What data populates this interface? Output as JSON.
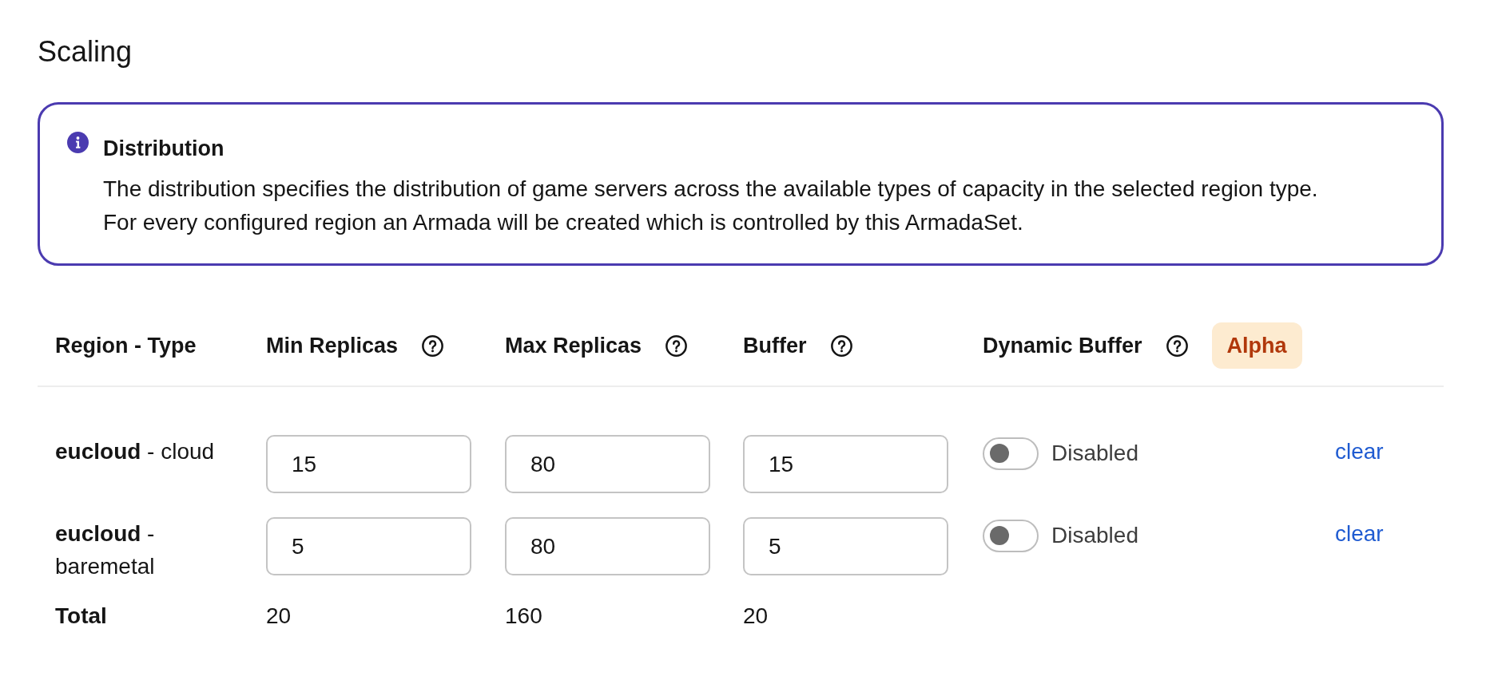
{
  "title": "Scaling",
  "alert": {
    "kind": "info",
    "title": "Distribution",
    "lines": [
      "The distribution specifies the distribution of game servers across the available types of capacity in the selected region type.",
      "For every configured region an Armada will be created which is controlled by this ArmadaSet."
    ]
  },
  "table": {
    "columns": [
      {
        "label": "Region - Type",
        "help": false
      },
      {
        "label": "Min Replicas",
        "help": true
      },
      {
        "label": "Max Replicas",
        "help": true
      },
      {
        "label": "Buffer",
        "help": true
      },
      {
        "label": "Dynamic Buffer",
        "help": true,
        "badge": "Alpha"
      }
    ],
    "rows": [
      {
        "region": "**eucloud** - cloud",
        "min_replicas": "15",
        "max_replicas": "80",
        "buffer": "15",
        "dynamic_buffer": {
          "on": false,
          "label": "Disabled"
        },
        "action": "clear"
      },
      {
        "region": "**eucloud** - baremetal",
        "min_replicas": "5",
        "max_replicas": "80",
        "buffer": "5",
        "dynamic_buffer": {
          "on": false,
          "label": "Disabled"
        },
        "action": "clear"
      }
    ],
    "total": {
      "label": "Total",
      "min_replicas": "20",
      "max_replicas": "160",
      "buffer": "20"
    }
  }
}
